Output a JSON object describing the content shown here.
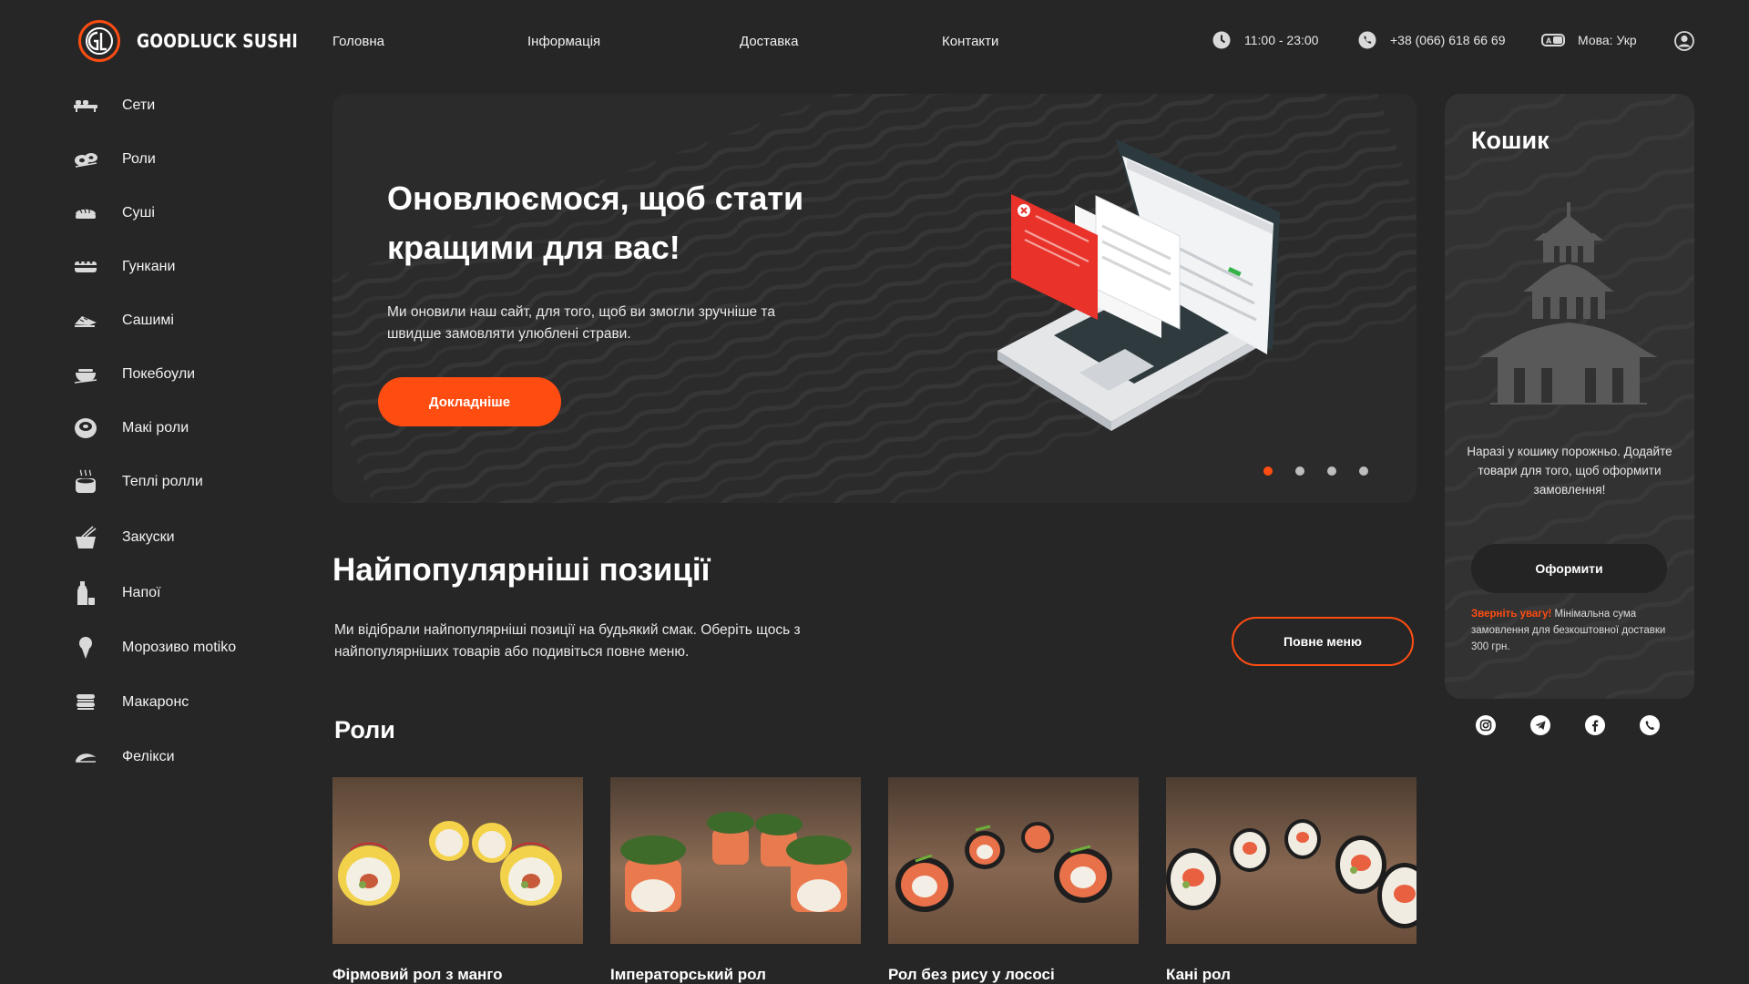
{
  "brand": {
    "name": "GOODLUCK SUSHI",
    "accent_color": "#ff4d12",
    "background_color": "#262626"
  },
  "nav": [
    {
      "label": "Головна"
    },
    {
      "label": "Інформація"
    },
    {
      "label": "Доставка"
    },
    {
      "label": "Контакти"
    }
  ],
  "header": {
    "hours": "11:00 - 23:00",
    "phone": "+38 (066) 618 66 69",
    "language": "Мова: Укр",
    "icons": [
      "clock-icon",
      "phone-icon",
      "language-icon",
      "user-icon"
    ]
  },
  "sidebar": {
    "items": [
      {
        "label": "Сети",
        "icon": "sets-icon"
      },
      {
        "label": "Роли",
        "icon": "rolls-icon"
      },
      {
        "label": "Суші",
        "icon": "sushi-icon"
      },
      {
        "label": "Гункани",
        "icon": "gunkan-icon"
      },
      {
        "label": "Сашимі",
        "icon": "sashimi-icon"
      },
      {
        "label": "Покебоули",
        "icon": "poke-bowl-icon"
      },
      {
        "label": "Макі роли",
        "icon": "maki-icon"
      },
      {
        "label": "Теплі ролли",
        "icon": "warm-rolls-icon"
      },
      {
        "label": "Закуски",
        "icon": "snacks-icon"
      },
      {
        "label": "Напої",
        "icon": "drinks-icon"
      },
      {
        "label": "Морозиво motiko",
        "icon": "ice-cream-icon"
      },
      {
        "label": "Макаронс",
        "icon": "macarons-icon"
      },
      {
        "label": "Фелікси",
        "icon": "felix-icon"
      }
    ]
  },
  "hero": {
    "title": "Оновлюємося, щоб стати кращими для вас!",
    "text": "Ми оновили наш сайт, для того, щоб ви змогли зручніше та швидше замовляти улюблені страви.",
    "button": "Докладніше",
    "slides_total": 4,
    "slide_active": 1
  },
  "popular": {
    "title": "Найпопулярніші позиції",
    "text": "Ми відібрали найпопулярніші позиції на будьякий смак. Оберіть щось з найпопулярніших товарів або подивіться повне меню.",
    "button": "Повне меню"
  },
  "rolls": {
    "title": "Роли",
    "items": [
      {
        "name": "Фірмовий рол з манго"
      },
      {
        "name": "Імператорський рол"
      },
      {
        "name": "Рол без рису у лососі"
      },
      {
        "name": "Кані рол"
      }
    ]
  },
  "cart": {
    "title": "Кошик",
    "empty_text": "Наразі у кошику порожньо. Додайте товари для того, щоб оформити замовлення!",
    "button": "Оформити",
    "note_attention": "Зверніть увагу!",
    "note_text": " Мінімальна сума замовлення для безкоштовної доставки 300 грн."
  },
  "socials": [
    {
      "icon": "instagram-icon"
    },
    {
      "icon": "telegram-icon"
    },
    {
      "icon": "facebook-icon"
    },
    {
      "icon": "viber-icon"
    }
  ]
}
